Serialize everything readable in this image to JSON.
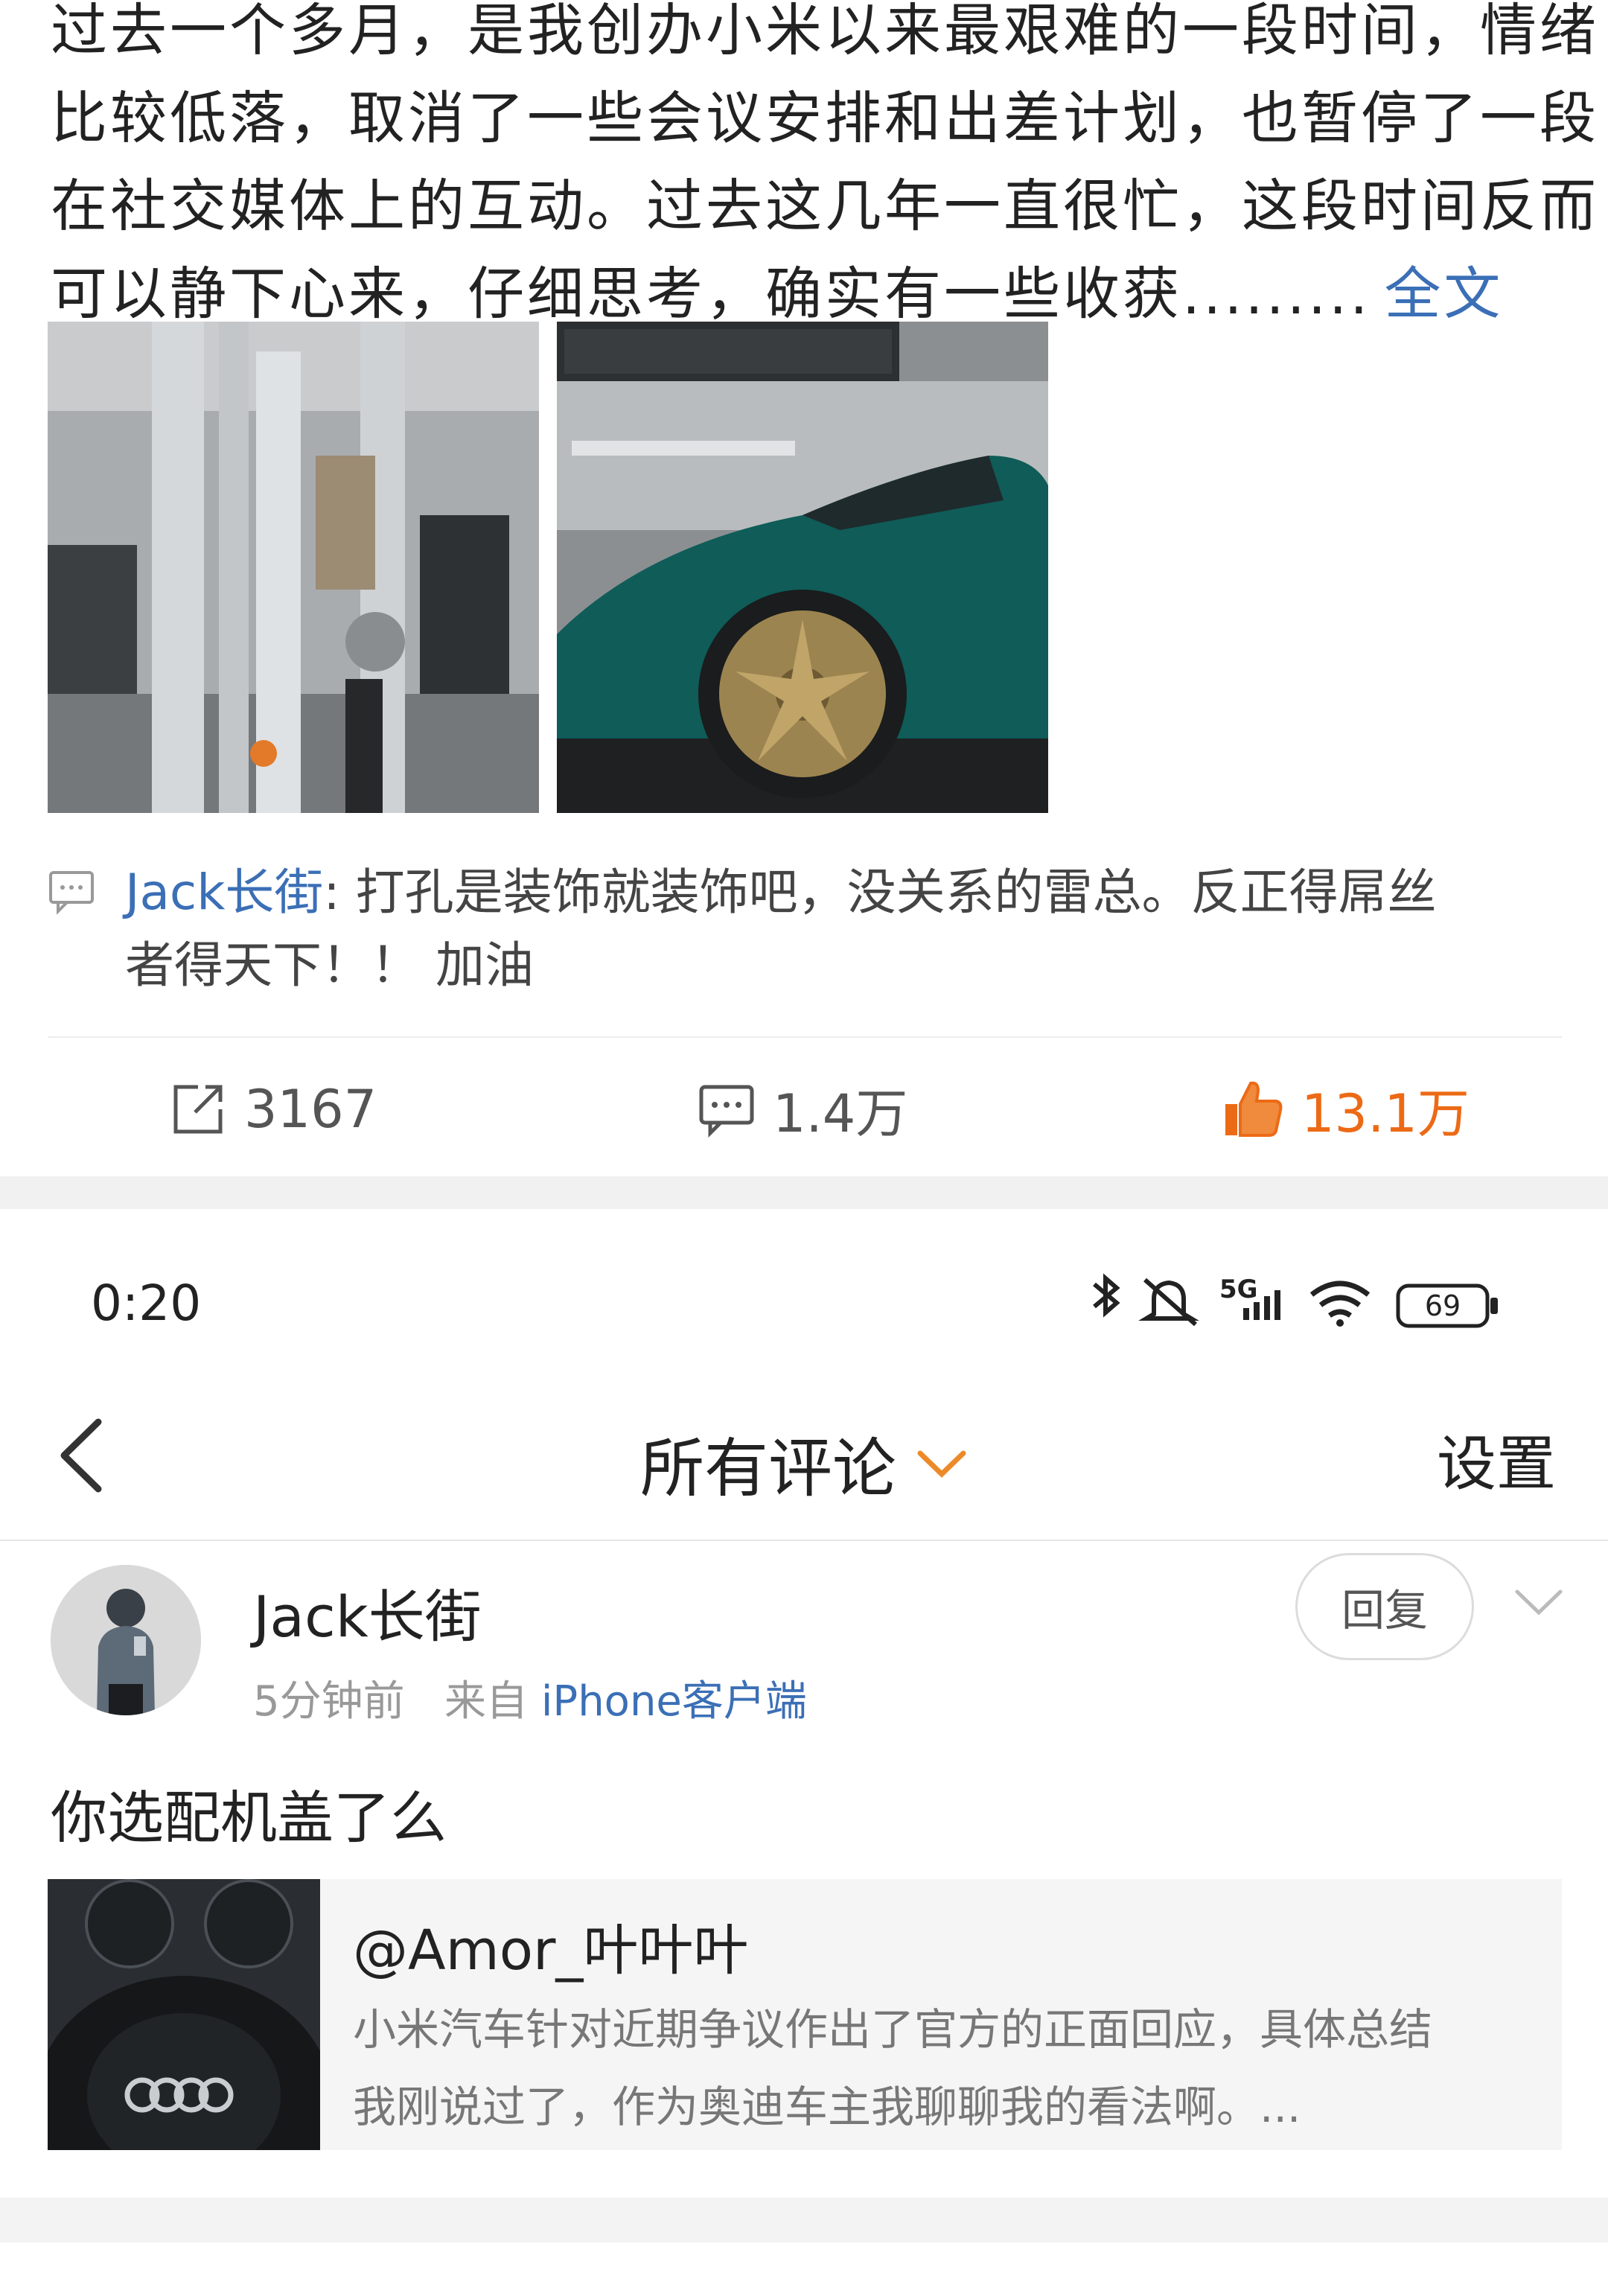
{
  "post": {
    "lines": [
      "过去一个多月，是我创办小米以来最艰难的一段时间，情绪",
      "比较低落，取消了一些会议安排和出差计划，也暂停了一段",
      "在社交媒体上的互动。过去这几年一直很忙，这段时间反而",
      "可以静下心来，仔细思考，确实有一些收获........."
    ],
    "more_label": "全文",
    "comment_preview": {
      "name": "Jack长街",
      "separator": ": ",
      "text": "打孔是装饰就装饰吧，没关系的雷总。反正得屌丝",
      "text2": "者得天下！！ 加油"
    },
    "actions": {
      "repost": "3167",
      "comment": "1.4万",
      "like": "13.1万"
    }
  },
  "status_bar": {
    "time": "0:20",
    "network": "5G",
    "battery": "69"
  },
  "nav": {
    "title": "所有评论",
    "settings": "设置"
  },
  "comment": {
    "user": "Jack长街",
    "time": "5分钟前",
    "from_label": "来自",
    "source": "iPhone客户端",
    "reply_label": "回复",
    "body": "你选配机盖了么",
    "quote": {
      "user": "@Amor_叶叶叶",
      "text_line1": "小米汽车针对近期争议作出了官方的正面回应，具体总结",
      "text_line2": "我刚说过了，作为奥迪车主我聊聊我的看法啊。..."
    }
  },
  "colors": {
    "link": "#3b6fb6",
    "like": "#ec6a16",
    "text": "#222222",
    "muted": "#999999"
  }
}
